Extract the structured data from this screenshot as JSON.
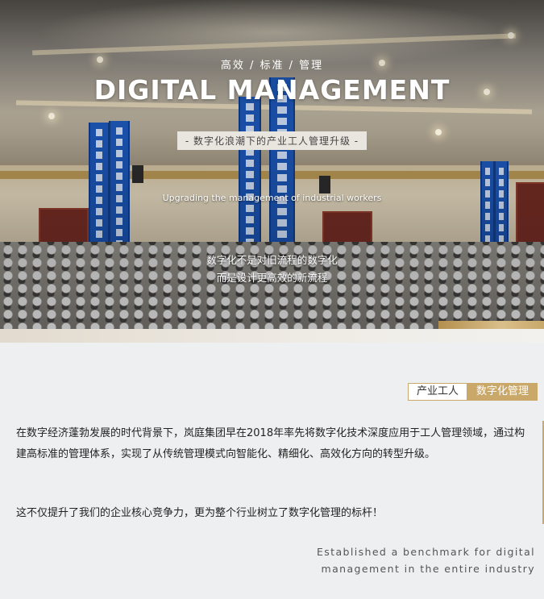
{
  "hero": {
    "subtitle": "高效 / 标准 / 管理",
    "title": "DIGITAL MANAGEMENT",
    "plate": "- 数字化浪潮下的产业工人管理升级 -",
    "english": "Upgrading the management of industrial workers",
    "line1": "数字化不是对旧流程的数字化",
    "line2": "而是设计更高效的新流程"
  },
  "tags": {
    "tag1": "产业工人",
    "tag2": "数字化管理"
  },
  "body": {
    "paragraph1": "在数字经济蓬勃发展的时代背景下，岚庭集团早在2018年率先将数字化技术深度应用于工人管理领域，通过构建高标准的管理体系，实现了从传统管理模式向智能化、精细化、高效化方向的转型升级。",
    "paragraph2": "这不仅提升了我们的企业核心竞争力，更为整个行业树立了数字化管理的标杆！"
  },
  "footer_english": {
    "line1": "Established a benchmark for digital",
    "line2": "management in the entire industry"
  },
  "colors": {
    "gold": "#c9a86a",
    "banner_blue": "#1c55b3"
  }
}
